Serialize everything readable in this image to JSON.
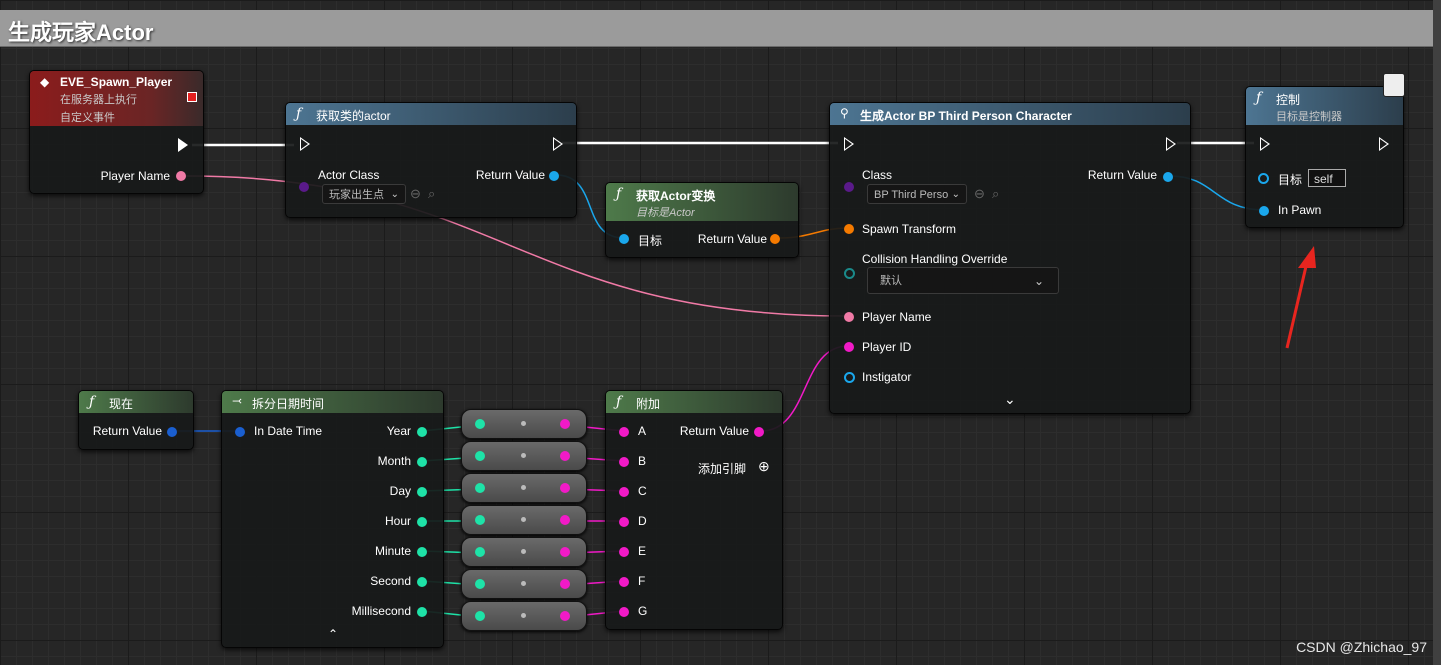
{
  "graph_title": "生成玩家Actor",
  "watermark": "CSDN @Zhichao_97",
  "colors": {
    "exec": "#ffffff",
    "string": "#f07aa6",
    "object": "#1aa7ec",
    "transform": "#f57a00",
    "int": "#1ee3a8",
    "event": "#8a1d1d",
    "function": "#4d7592",
    "pure": "#4e7a4a"
  },
  "event_node": {
    "title": "EVE_Spawn_Player",
    "subtitle1": "在服务器上执行",
    "subtitle2": "自定义事件",
    "pin_player_name": "Player Name"
  },
  "get_class_node": {
    "title": "获取类的actor",
    "pin_actor_class": "Actor Class",
    "pin_return": "Return Value",
    "dropdown": "玩家出生点"
  },
  "get_transform_node": {
    "title": "获取Actor变换",
    "subtitle": "目标是Actor",
    "pin_target": "目标",
    "pin_return": "Return Value"
  },
  "spawn_node": {
    "title": "生成Actor BP Third Person Character",
    "pin_class": "Class",
    "class_value": "BP Third Perso",
    "pin_return": "Return Value",
    "pin_spawn_transform": "Spawn Transform",
    "pin_collision": "Collision Handling Override",
    "collision_value": "默认",
    "pin_player_name": "Player Name",
    "pin_player_id": "Player ID",
    "pin_instigator": "Instigator"
  },
  "possess_node": {
    "title": "控制",
    "subtitle": "目标是控制器",
    "pin_target": "目标",
    "target_value": "self",
    "pin_in_pawn": "In Pawn"
  },
  "now_node": {
    "title": "现在",
    "pin_return": "Return Value"
  },
  "break_node": {
    "title": "拆分日期时间",
    "pin_in": "In Date Time",
    "outputs": [
      "Year",
      "Month",
      "Day",
      "Hour",
      "Minute",
      "Second",
      "Millisecond"
    ]
  },
  "append_node": {
    "title": "附加",
    "inputs": [
      "A",
      "B",
      "C",
      "D",
      "E",
      "F",
      "G"
    ],
    "pin_return": "Return Value",
    "add_pin": "添加引脚"
  }
}
